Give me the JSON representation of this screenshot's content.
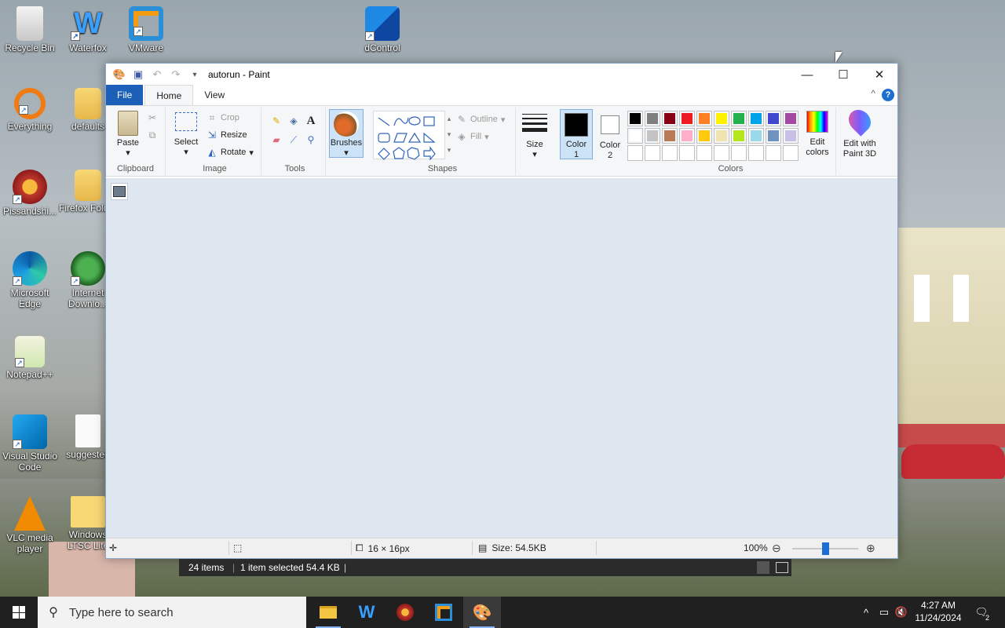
{
  "desktop": {
    "icons": [
      {
        "label": "Recycle Bin",
        "icon": "recycle-bin-icon"
      },
      {
        "label": "Waterfox",
        "icon": "waterfox-icon"
      },
      {
        "label": "VMware",
        "icon": "vmware-icon"
      },
      {
        "label": "dControl",
        "icon": "dcontrol-icon"
      },
      {
        "label": "Everything",
        "icon": "everything-search-icon"
      },
      {
        "label": "defaults",
        "icon": "folder-icon"
      },
      {
        "label": "Pissandshi...",
        "icon": "browser-icon"
      },
      {
        "label": "Firefox Folder",
        "icon": "folder-icon"
      },
      {
        "label": "Microsoft Edge",
        "icon": "edge-icon"
      },
      {
        "label": "Internet Downlo...",
        "icon": "internet-download-manager-icon"
      },
      {
        "label": "Notepad++",
        "icon": "notepad-plus-plus-icon"
      },
      {
        "label": "Visual Studio Code",
        "icon": "vscode-icon"
      },
      {
        "label": "suggested",
        "icon": "document-icon"
      },
      {
        "label": "VLC media player",
        "icon": "vlc-icon"
      },
      {
        "label": "Windows LTSC Lite",
        "icon": "iso-file-icon"
      }
    ]
  },
  "paint": {
    "title": "autorun - Paint",
    "tabs": {
      "file": "File",
      "home": "Home",
      "view": "View"
    },
    "help": "?",
    "clipboard": {
      "paste": "Paste",
      "group": "Clipboard"
    },
    "image": {
      "select": "Select",
      "crop": "Crop",
      "resize": "Resize",
      "rotate": "Rotate",
      "group": "Image"
    },
    "tools": {
      "group": "Tools",
      "text_glyph": "A"
    },
    "brushes": {
      "label": "Brushes"
    },
    "shapes": {
      "outline": "Outline",
      "fill": "Fill",
      "group": "Shapes"
    },
    "size": {
      "label": "Size"
    },
    "color1": {
      "label1": "Color",
      "label2": "1",
      "value": "#000000"
    },
    "color2": {
      "label1": "Color",
      "label2": "2",
      "value": "#ffffff"
    },
    "colors": {
      "group": "Colors",
      "palette_row1": [
        "#000000",
        "#7f7f7f",
        "#880015",
        "#ed1c24",
        "#ff7f27",
        "#fff200",
        "#22b14c",
        "#00a2e8",
        "#3f48cc",
        "#a349a4"
      ],
      "palette_row2": [
        "#ffffff",
        "#c3c3c3",
        "#b97a57",
        "#ffaec9",
        "#ffc90e",
        "#efe4b0",
        "#b5e61d",
        "#99d9ea",
        "#7092be",
        "#c8bfe7"
      ]
    },
    "edit_colors": {
      "line1": "Edit",
      "line2": "colors"
    },
    "paint3d": {
      "line1": "Edit with",
      "line2": "Paint 3D"
    },
    "status": {
      "dimensions": "16 × 16px",
      "size": "Size: 54.5KB",
      "zoom": "100%",
      "zoom_level": 0.5
    }
  },
  "explorer": {
    "items": "24 items",
    "selected": "1 item selected  54.4 KB"
  },
  "taskbar": {
    "search_placeholder": "Type here to search",
    "time": "4:27 AM",
    "date": "11/24/2024",
    "notifications": "2"
  }
}
